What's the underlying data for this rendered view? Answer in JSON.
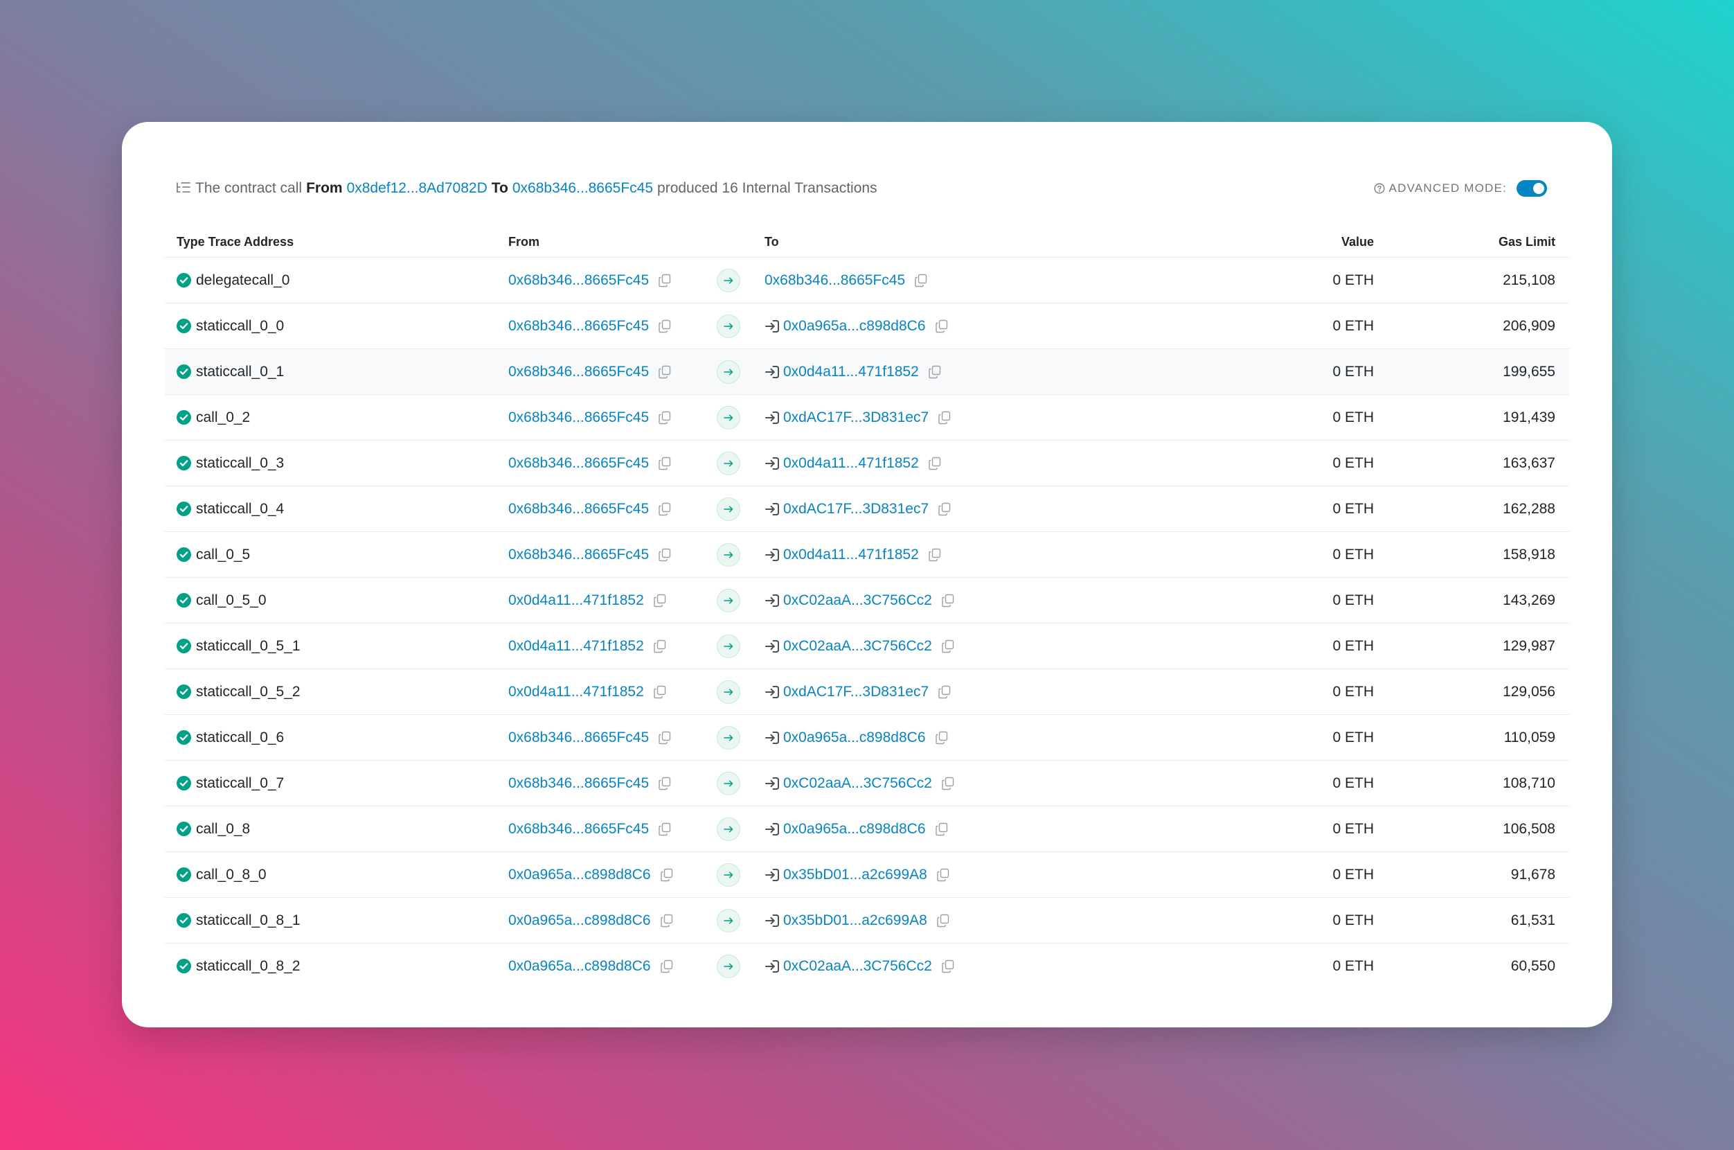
{
  "summary": {
    "prefix": "The contract call",
    "from_label": "From",
    "from_address": "0x8def12...8Ad7082D",
    "to_label": "To",
    "to_address": "0x68b346...8665Fc45",
    "suffix": "produced 16 Internal Transactions"
  },
  "advanced_mode": {
    "label": "ADVANCED MODE:",
    "enabled": true
  },
  "columns": {
    "type": "Type Trace Address",
    "from": "From",
    "to": "To",
    "value": "Value",
    "gas": "Gas Limit"
  },
  "colors": {
    "link": "#0784c3",
    "success": "#00a186",
    "toggle": "#0784c3"
  },
  "icons": {
    "status": "check-circle-icon",
    "copy": "copy-icon",
    "arrow": "arrow-right-icon",
    "contract": "enter-icon"
  },
  "rows": [
    {
      "type": "delegatecall_0",
      "from": "0x68b346...8665Fc45",
      "to": "0x68b346...8665Fc45",
      "to_contract_icon": false,
      "value": "0 ETH",
      "gas": "215,108"
    },
    {
      "type": "staticcall_0_0",
      "from": "0x68b346...8665Fc45",
      "to": "0x0a965a...c898d8C6",
      "to_contract_icon": true,
      "value": "0 ETH",
      "gas": "206,909"
    },
    {
      "type": "staticcall_0_1",
      "from": "0x68b346...8665Fc45",
      "to": "0x0d4a11...471f1852",
      "to_contract_icon": true,
      "value": "0 ETH",
      "gas": "199,655"
    },
    {
      "type": "call_0_2",
      "from": "0x68b346...8665Fc45",
      "to": "0xdAC17F...3D831ec7",
      "to_contract_icon": true,
      "value": "0 ETH",
      "gas": "191,439"
    },
    {
      "type": "staticcall_0_3",
      "from": "0x68b346...8665Fc45",
      "to": "0x0d4a11...471f1852",
      "to_contract_icon": true,
      "value": "0 ETH",
      "gas": "163,637"
    },
    {
      "type": "staticcall_0_4",
      "from": "0x68b346...8665Fc45",
      "to": "0xdAC17F...3D831ec7",
      "to_contract_icon": true,
      "value": "0 ETH",
      "gas": "162,288"
    },
    {
      "type": "call_0_5",
      "from": "0x68b346...8665Fc45",
      "to": "0x0d4a11...471f1852",
      "to_contract_icon": true,
      "value": "0 ETH",
      "gas": "158,918"
    },
    {
      "type": "call_0_5_0",
      "from": "0x0d4a11...471f1852",
      "to": "0xC02aaA...3C756Cc2",
      "to_contract_icon": true,
      "value": "0 ETH",
      "gas": "143,269"
    },
    {
      "type": "staticcall_0_5_1",
      "from": "0x0d4a11...471f1852",
      "to": "0xC02aaA...3C756Cc2",
      "to_contract_icon": true,
      "value": "0 ETH",
      "gas": "129,987"
    },
    {
      "type": "staticcall_0_5_2",
      "from": "0x0d4a11...471f1852",
      "to": "0xdAC17F...3D831ec7",
      "to_contract_icon": true,
      "value": "0 ETH",
      "gas": "129,056"
    },
    {
      "type": "staticcall_0_6",
      "from": "0x68b346...8665Fc45",
      "to": "0x0a965a...c898d8C6",
      "to_contract_icon": true,
      "value": "0 ETH",
      "gas": "110,059"
    },
    {
      "type": "staticcall_0_7",
      "from": "0x68b346...8665Fc45",
      "to": "0xC02aaA...3C756Cc2",
      "to_contract_icon": true,
      "value": "0 ETH",
      "gas": "108,710"
    },
    {
      "type": "call_0_8",
      "from": "0x68b346...8665Fc45",
      "to": "0x0a965a...c898d8C6",
      "to_contract_icon": true,
      "value": "0 ETH",
      "gas": "106,508"
    },
    {
      "type": "call_0_8_0",
      "from": "0x0a965a...c898d8C6",
      "to": "0x35bD01...a2c699A8",
      "to_contract_icon": true,
      "value": "0 ETH",
      "gas": "91,678"
    },
    {
      "type": "staticcall_0_8_1",
      "from": "0x0a965a...c898d8C6",
      "to": "0x35bD01...a2c699A8",
      "to_contract_icon": true,
      "value": "0 ETH",
      "gas": "61,531"
    },
    {
      "type": "staticcall_0_8_2",
      "from": "0x0a965a...c898d8C6",
      "to": "0xC02aaA...3C756Cc2",
      "to_contract_icon": true,
      "value": "0 ETH",
      "gas": "60,550"
    }
  ],
  "highlighted_row": 2
}
